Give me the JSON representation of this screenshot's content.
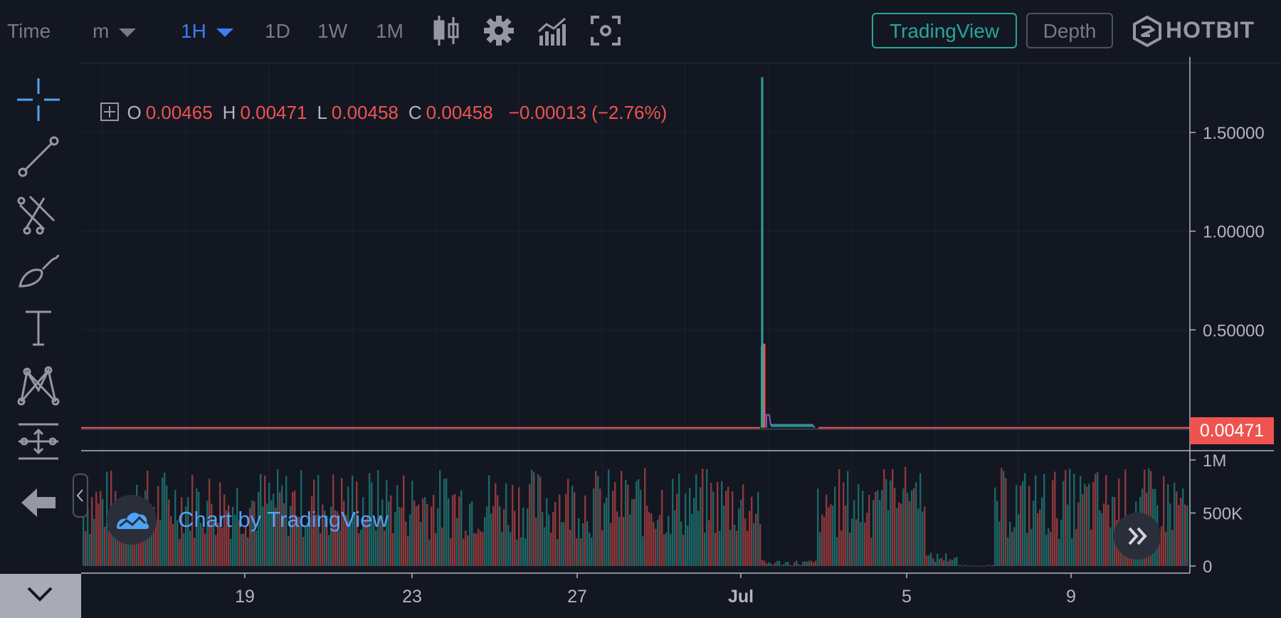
{
  "toolbar": {
    "time_label": "Time",
    "minute_label": "m",
    "interval_selected": "1H",
    "intervals": [
      "1D",
      "1W",
      "1M"
    ],
    "icons": [
      "candlestick-icon",
      "gear-icon",
      "indicators-icon",
      "screenshot-icon"
    ],
    "tradingview_button": "TradingView",
    "depth_button": "Depth",
    "brand": "HOTBIT"
  },
  "legend": {
    "o_label": "O",
    "o_value": "0.00465",
    "h_label": "H",
    "h_value": "0.00471",
    "l_label": "L",
    "l_value": "0.00458",
    "c_label": "C",
    "c_value": "0.00458",
    "change": "−0.00013 (−2.76%)"
  },
  "badge": {
    "text": "Chart by TradingView"
  },
  "sidebar": {
    "tools": [
      "crosshair-icon",
      "trend-line-icon",
      "fib-tool-icon",
      "brush-icon",
      "text-tool-icon",
      "pattern-tool-icon",
      "measure-tool-icon",
      "back-arrow-icon"
    ]
  },
  "colors": {
    "up": "#26a69a",
    "down": "#ef5350",
    "background": "#131722",
    "grid": "#1e222d",
    "axis_text": "#b2b5be"
  },
  "chart_data": {
    "type": "candlestick",
    "last_price": "0.00471",
    "price_axis": {
      "ticks": [
        0.5,
        1.0,
        1.5
      ],
      "tick_labels": [
        "0.50000",
        "1.00000",
        "1.50000"
      ],
      "ylim": [
        0,
        1.8
      ]
    },
    "volume_axis": {
      "ticks": [
        0,
        500000,
        1000000
      ],
      "tick_labels": [
        "0",
        "500K",
        "1M"
      ],
      "ylim": [
        0,
        1000000
      ]
    },
    "x_ticks": [
      "19",
      "23",
      "27",
      "Jul",
      "5",
      "9"
    ],
    "spike": {
      "date": "Jul 1",
      "high": 1.78,
      "open": 0.0047,
      "close": 0.42,
      "next_high": 0.43
    },
    "baseline_price": 0.0047
  }
}
